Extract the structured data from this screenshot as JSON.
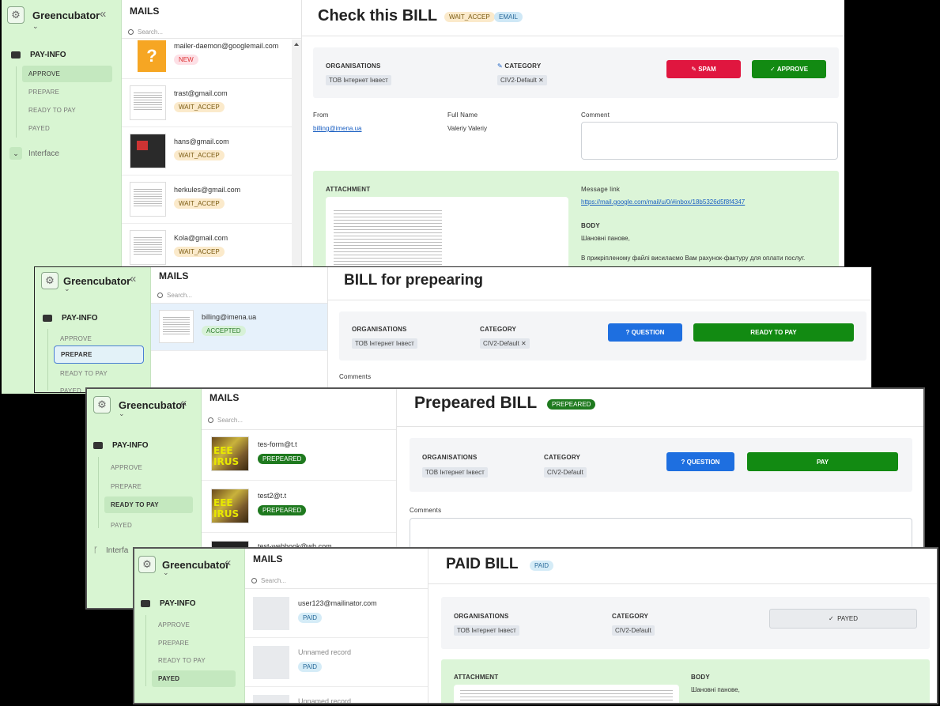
{
  "brand": "Greencubator",
  "mails_title": "MAILS",
  "search_placeholder": "Search...",
  "sidebar": {
    "section": "PAY-INFO",
    "items": [
      "APPROVE",
      "PREPARE",
      "READY TO PAY",
      "PAYED"
    ],
    "interface_full": "Interface",
    "interface_short": "Interfa"
  },
  "w1": {
    "title": "Check this BILL",
    "status": "WAIT_ACCEP",
    "source": "EMAIL",
    "mails": [
      {
        "sender": "mailer-daemon@googlemail.com",
        "badge": "NEW"
      },
      {
        "sender": "trast@gmail.com",
        "badge": "WAIT_ACCEP"
      },
      {
        "sender": "hans@gmail.com",
        "badge": "WAIT_ACCEP"
      },
      {
        "sender": "herkules@gmail.com",
        "badge": "WAIT_ACCEP"
      },
      {
        "sender": "Kola@gmail.com",
        "badge": "WAIT_ACCEP"
      }
    ],
    "organisations_label": "ORGANISATIONS",
    "organisation": "ТОВ Інтернет Інвест",
    "category_label": "CATEGORY",
    "category": "CIV2-Default",
    "spam_label": "SPAM",
    "approve_label": "APPROVE",
    "from_label": "From",
    "from_value": "billing@imena.ua",
    "fullname_label": "Full Name",
    "fullname_value": "Valeriy Valeriy",
    "comment_label": "Comment",
    "attachment_label": "ATTACHMENT",
    "msglink_label": "Message link",
    "msglink_value": "https://mail.google.com/mail/u/0/#inbox/18b5326d5f8f4347",
    "body_label": "BODY",
    "body_line1": "Шановні панове,",
    "body_line2": "В прикріпленому файлі висилаємо Вам рахунок-фактуру для оплати послуг."
  },
  "w2": {
    "title": "BILL for prepearing",
    "mails": [
      {
        "sender": "billing@imena.ua",
        "badge": "ACCEPTED"
      }
    ],
    "organisations_label": "ORGANISATIONS",
    "organisation": "ТОВ Інтернет Інвест",
    "category_label": "CATEGORY",
    "category": "CIV2-Default",
    "question_label": "QUESTION",
    "ready_label": "READY TO PAY",
    "comments_label": "Comments"
  },
  "w3": {
    "title": "Prepeared BILL",
    "status": "PREPEARED",
    "mails": [
      {
        "sender": "tes-form@t.t",
        "badge": "PREPEARED"
      },
      {
        "sender": "test2@t.t",
        "badge": "PREPEARED"
      },
      {
        "sender": "test-webhook@wh.com",
        "badge": ""
      }
    ],
    "virus_text": "EEE\nIRUS",
    "organisations_label": "ORGANISATIONS",
    "organisation": "ТОВ Інтернет Інвест",
    "category_label": "CATEGORY",
    "category": "CIV2-Default",
    "question_label": "QUESTION",
    "pay_label": "PAY",
    "comments_label": "Comments"
  },
  "w4": {
    "title": "PAID BILL",
    "status": "PAID",
    "mails": [
      {
        "sender": "user123@mailinator.com",
        "badge": "PAID"
      },
      {
        "sender": "Unnamed record",
        "badge": "PAID"
      },
      {
        "sender": "Unnamed record",
        "badge": ""
      }
    ],
    "organisations_label": "ORGANISATIONS",
    "organisation": "ТОВ Інтернет Інвест",
    "category_label": "CATEGORY",
    "category": "CIV2-Default",
    "payed_label": "PAYED",
    "attachment_label": "ATTACHMENT",
    "body_label": "BODY",
    "body_line1": "Шановні панове,"
  },
  "icons": {
    "logo": "gear-logo-icon",
    "collapse": "double-chevron-left-icon",
    "briefcase": "briefcase-icon",
    "search": "search-icon",
    "question": "question-icon",
    "check": "check-icon",
    "edit": "pencil-icon"
  },
  "colors": {
    "sidebar": "#d8f5d2",
    "spam": "#e0163f",
    "approve": "#128a12",
    "question": "#1e6fe0"
  }
}
